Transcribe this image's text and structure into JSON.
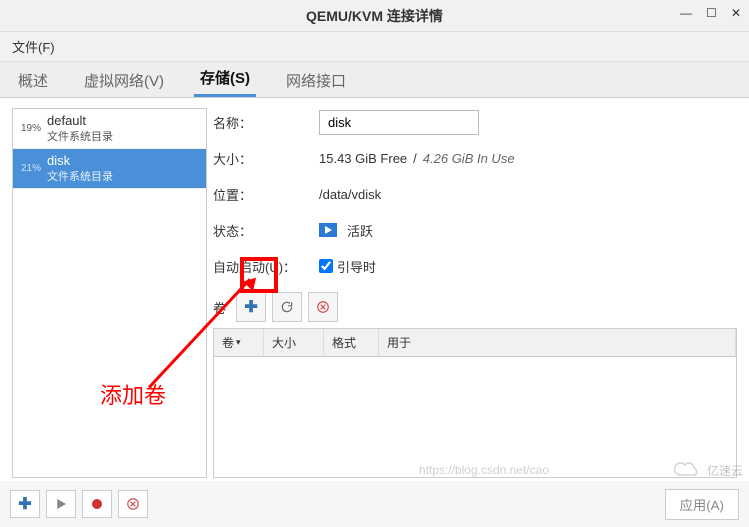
{
  "titlebar": {
    "title": "QEMU/KVM 连接详情"
  },
  "menubar": {
    "file": "文件(F)"
  },
  "tabs": {
    "overview": "概述",
    "vnet": "虚拟网络(V)",
    "storage": "存储(S)",
    "netif": "网络接口"
  },
  "pools": [
    {
      "pct": "19%",
      "name": "default",
      "sub": "文件系统目录"
    },
    {
      "pct": "21%",
      "name": "disk",
      "sub": "文件系统目录"
    }
  ],
  "detail": {
    "name_label": "名称：",
    "name_value": "disk",
    "size_label": "大小：",
    "size_free": "15.43 GiB Free",
    "size_sep": " / ",
    "size_used": "4.26 GiB In Use",
    "location_label": "位置：",
    "location_value": "/data/vdisk",
    "state_label": "状态：",
    "state_value": "活跃",
    "autostart_label": "自动启动(U)：",
    "autostart_value": "引导时",
    "volumes_label": "卷"
  },
  "vol_table": {
    "col_name": "卷",
    "col_size": "大小",
    "col_fmt": "格式",
    "col_use": "用于"
  },
  "annotation": {
    "text": "添加卷"
  },
  "bottom": {
    "apply": "应用(A)"
  },
  "watermark": {
    "brand": "亿速云",
    "url": "https://blog.csdn.net/cao"
  }
}
